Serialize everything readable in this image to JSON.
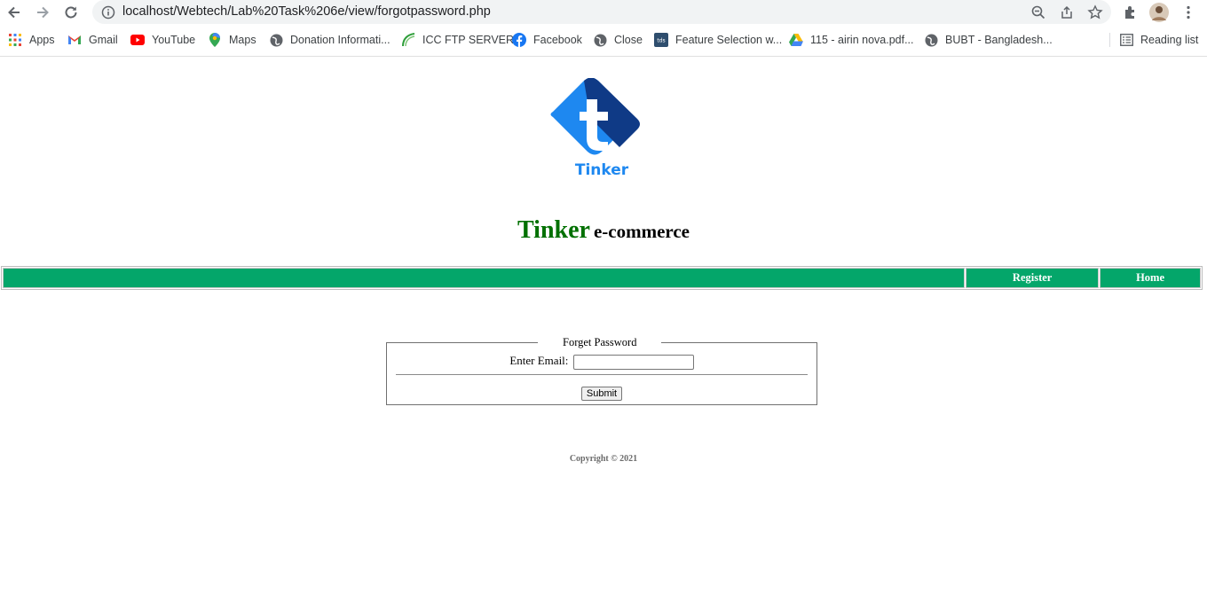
{
  "browser": {
    "url": "localhost/Webtech/Lab%20Task%206e/view/forgotpassword.php",
    "reading_list_label": "Reading list",
    "bookmarks": [
      {
        "label": "Apps",
        "icon": "apps-grid-icon"
      },
      {
        "label": "Gmail",
        "icon": "gmail-icon"
      },
      {
        "label": "YouTube",
        "icon": "youtube-icon"
      },
      {
        "label": "Maps",
        "icon": "maps-pin-icon"
      },
      {
        "label": "Donation Informati...",
        "icon": "globe-icon"
      },
      {
        "label": "ICC FTP SERVER",
        "icon": "icc-leaf-icon"
      },
      {
        "label": "Facebook",
        "icon": "facebook-icon"
      },
      {
        "label": "Close",
        "icon": "globe-icon"
      },
      {
        "label": "Feature Selection w...",
        "icon": "tds-icon"
      },
      {
        "label": "115 - airin nova.pdf...",
        "icon": "drive-icon"
      },
      {
        "label": "BUBT - Bangladesh...",
        "icon": "globe-icon"
      }
    ]
  },
  "page": {
    "logo_text": "Tinker",
    "brand": "Tinker",
    "subtitle": "e-commerce",
    "nav": {
      "register": "Register",
      "home": "Home"
    },
    "form": {
      "legend": "Forget Password",
      "email_label": "Enter Email:",
      "email_value": "",
      "submit_label": "Submit"
    },
    "copyright": "Copyright © 2021"
  },
  "colors": {
    "brand_green": "#007000",
    "nav_green": "#04a66a",
    "logo_light_blue": "#1e88f0",
    "logo_dark_blue": "#0f3a86"
  }
}
